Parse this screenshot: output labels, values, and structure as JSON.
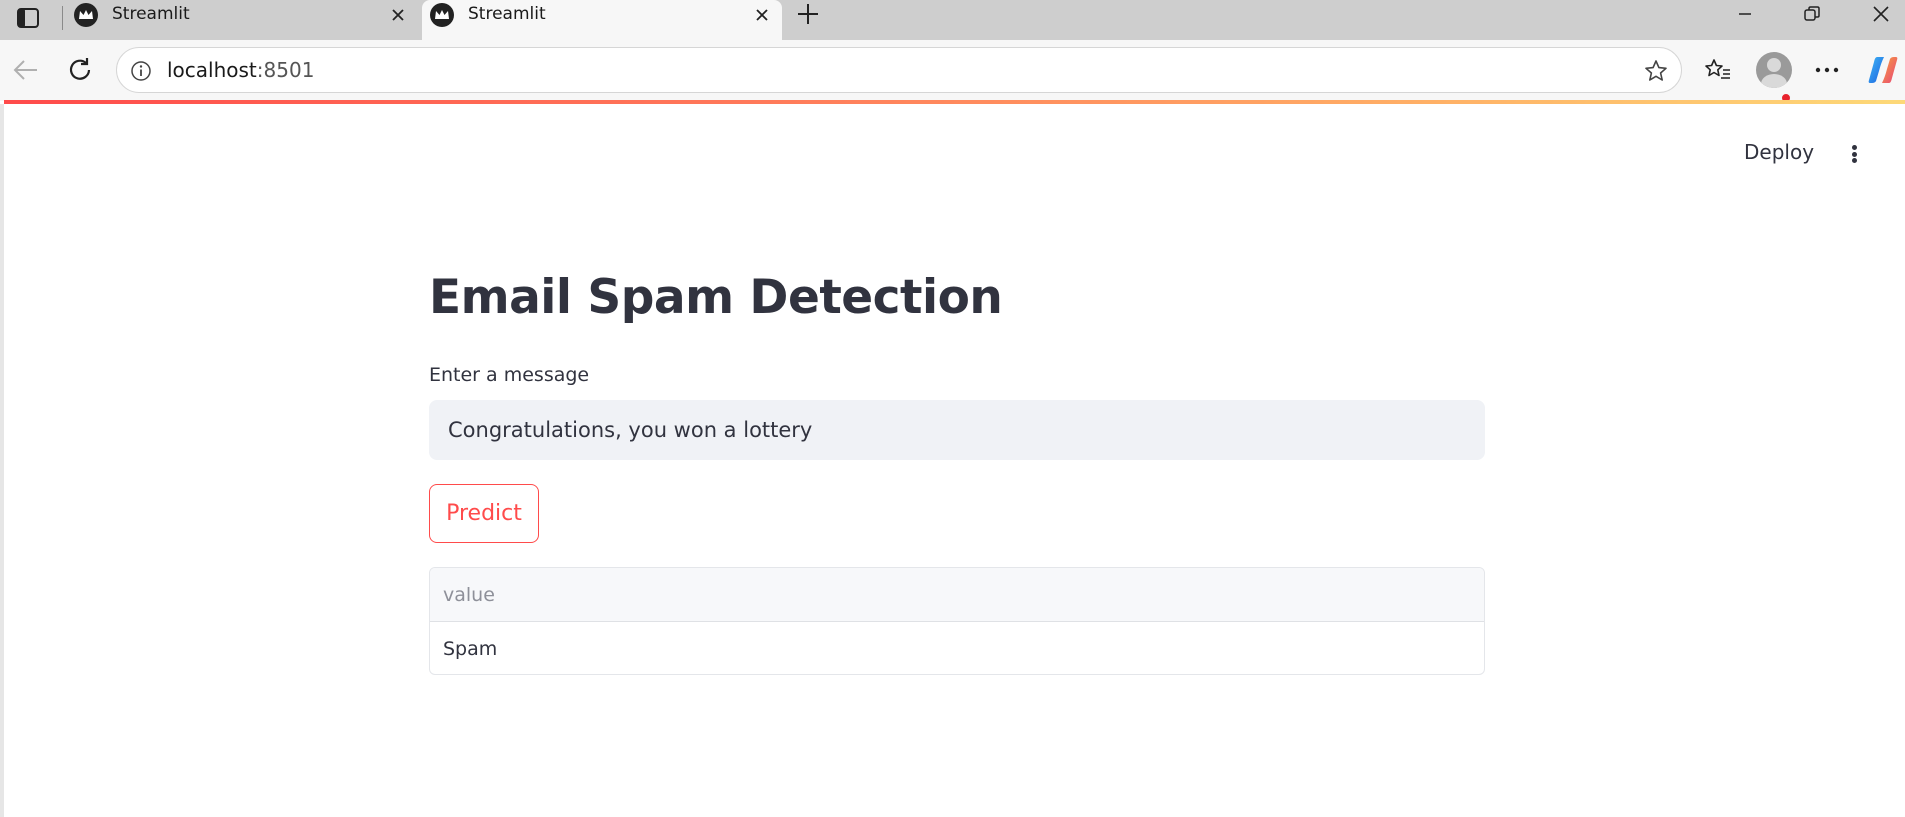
{
  "browser": {
    "tabs": [
      {
        "title": "Streamlit"
      },
      {
        "title": "Streamlit"
      }
    ],
    "url_host": "localhost",
    "url_port": ":8501"
  },
  "app": {
    "header": {
      "deploy_label": "Deploy"
    },
    "title": "Email Spam Detection",
    "input_label": "Enter a message",
    "input_value": "Congratulations, you won a lottery",
    "button_label": "Predict",
    "table": {
      "column": "value",
      "rows": [
        "Spam"
      ]
    }
  },
  "colors": {
    "accent": "#ff4b4b",
    "text": "#31333f",
    "input_bg": "#f0f2f6"
  }
}
